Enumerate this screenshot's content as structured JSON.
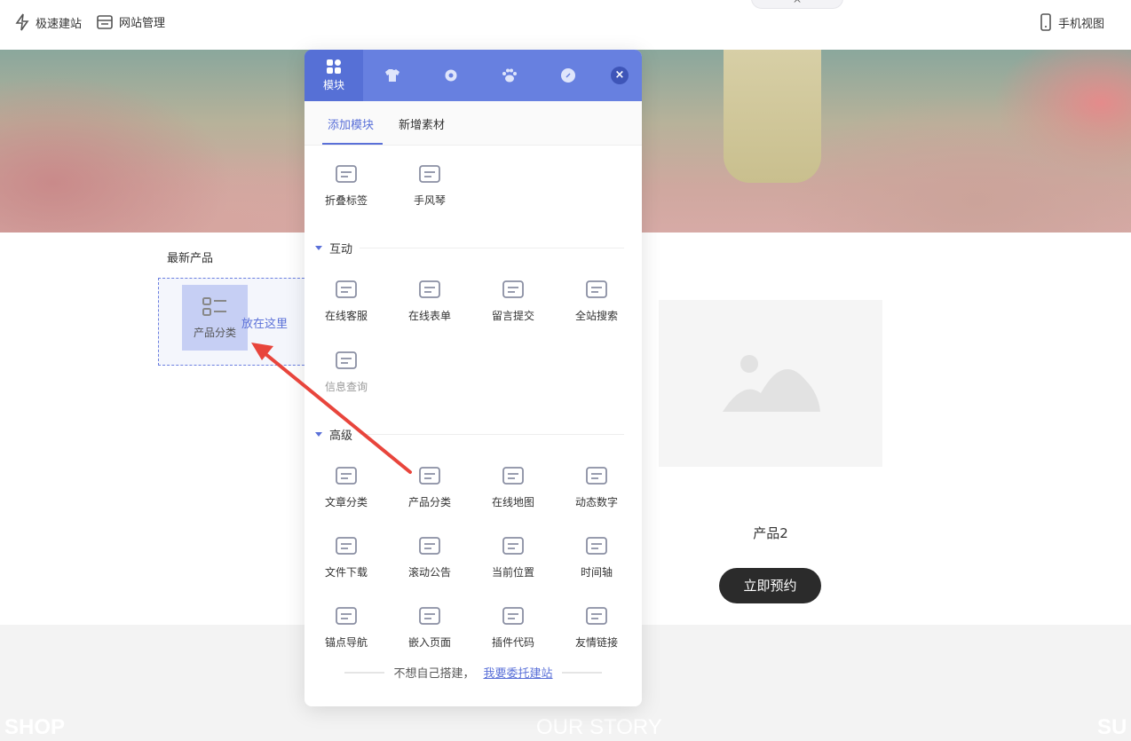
{
  "topbar": {
    "quick_build": "极速建站",
    "site_manage": "网站管理",
    "mobile_view": "手机视图",
    "collapse": "^"
  },
  "page": {
    "section_title": "最新产品",
    "drag_item": "产品分类",
    "drop_hint": "放在这里",
    "product_name": "产品2",
    "book_button": "立即预约",
    "footer_links": [
      "SHOP",
      "OUR STORY",
      "SU"
    ]
  },
  "panel": {
    "tabs": [
      {
        "label": "模块",
        "icon": "grid-icon"
      },
      {
        "icon": "shirt-icon"
      },
      {
        "icon": "gear-icon"
      },
      {
        "icon": "paw-icon"
      },
      {
        "icon": "link-icon"
      }
    ],
    "close": "×",
    "subtabs": [
      "添加模块",
      "新增素材"
    ],
    "basic": [
      "折叠标签",
      "手风琴"
    ],
    "sections": [
      {
        "title": "互动",
        "items": [
          "在线客服",
          "在线表单",
          "留言提交",
          "全站搜索",
          "信息查询"
        ]
      },
      {
        "title": "高级",
        "items": [
          "文章分类",
          "产品分类",
          "在线地图",
          "动态数字",
          "文件下载",
          "滚动公告",
          "当前位置",
          "时间轴",
          "锚点导航",
          "嵌入页面",
          "插件代码",
          "友情链接"
        ]
      }
    ],
    "footer_text": "不想自己搭建，",
    "footer_link": "我要委托建站"
  },
  "colors": {
    "accent": "#6780e0",
    "arrow": "#e8453c"
  }
}
